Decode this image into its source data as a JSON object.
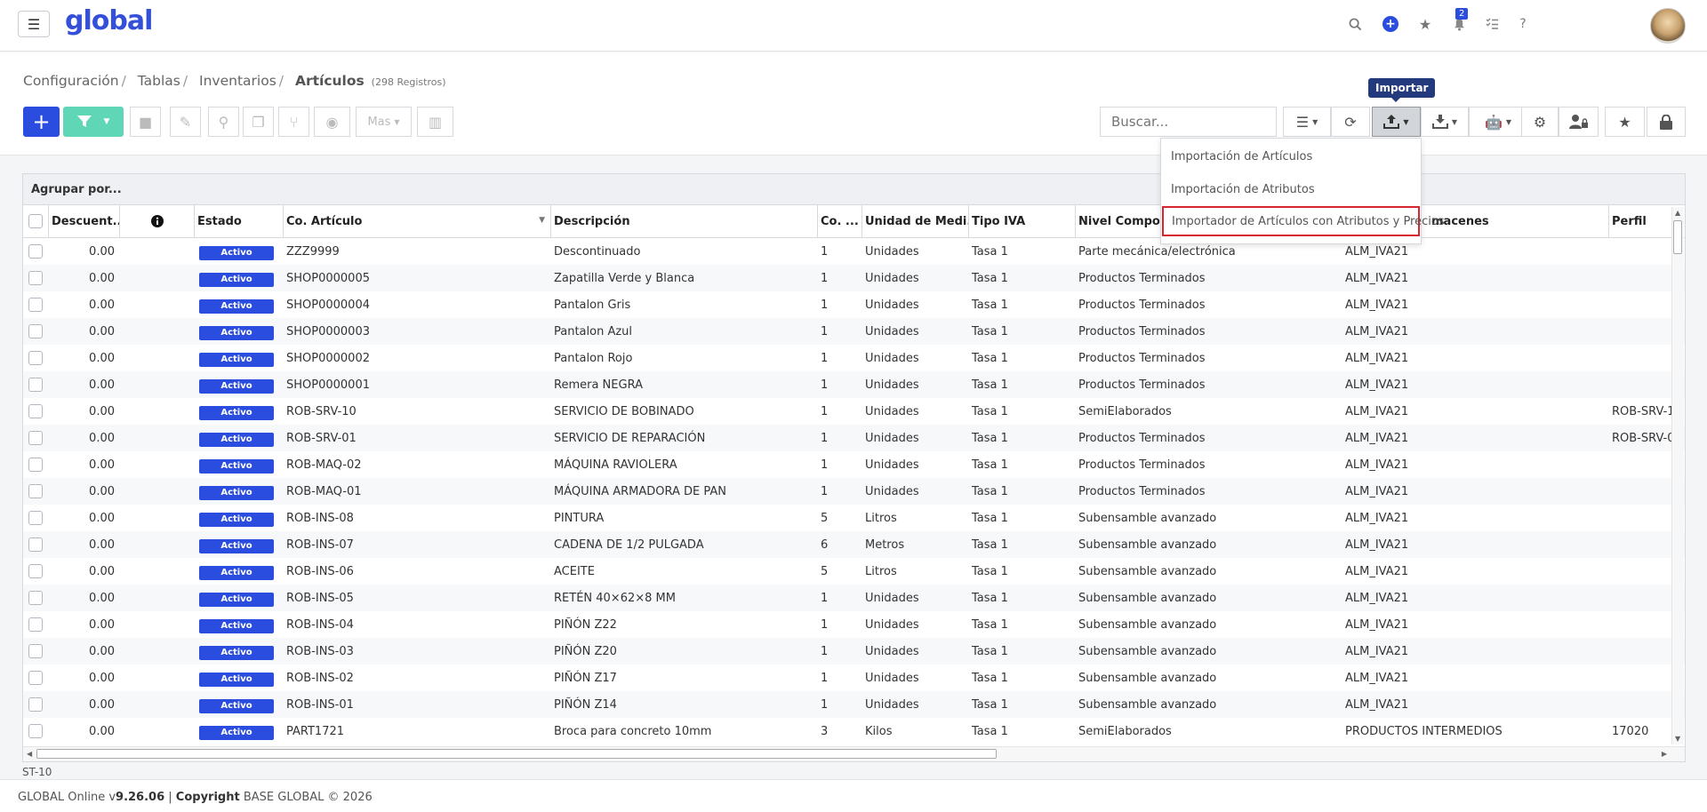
{
  "app": {
    "logo": "global"
  },
  "topbar": {
    "notifications_count": "2",
    "help_label": "?"
  },
  "breadcrumb": {
    "items": [
      "Configuración",
      "Tablas",
      "Inventarios"
    ],
    "current": "Artículos",
    "count": "(298 Registros)"
  },
  "toolbar": {
    "more_label": "Mas",
    "search_placeholder": "Buscar...",
    "tooltip": "Importar"
  },
  "import_menu": {
    "items": [
      "Importación de Artículos",
      "Importación de Atributos",
      "Importador de Artículos con Atributos y Precios"
    ]
  },
  "grid": {
    "group_by": "Agrupar por...",
    "columns": [
      "Descuent...",
      "",
      "Estado",
      "Co. Artículo",
      "Descripción",
      "Co. ...",
      "Unidad de Medi...",
      "Tipo IVA",
      "Nivel Composi",
      "macenes",
      "Perfil"
    ],
    "rows": [
      {
        "desc_pct": "0.00",
        "estado": "Activo",
        "codigo": "ZZZ9999",
        "descripcion": "Descontinuado",
        "co": "1",
        "unidad": "Unidades",
        "iva": "Tasa 1",
        "nivel": "Parte mecánica/electrónica",
        "almacen": "ALM_IVA21",
        "perfil": ""
      },
      {
        "desc_pct": "0.00",
        "estado": "Activo",
        "codigo": "SHOP0000005",
        "descripcion": "Zapatilla Verde y Blanca",
        "co": "1",
        "unidad": "Unidades",
        "iva": "Tasa 1",
        "nivel": "Productos Terminados",
        "almacen": "ALM_IVA21",
        "perfil": ""
      },
      {
        "desc_pct": "0.00",
        "estado": "Activo",
        "codigo": "SHOP0000004",
        "descripcion": "Pantalon Gris",
        "co": "1",
        "unidad": "Unidades",
        "iva": "Tasa 1",
        "nivel": "Productos Terminados",
        "almacen": "ALM_IVA21",
        "perfil": ""
      },
      {
        "desc_pct": "0.00",
        "estado": "Activo",
        "codigo": "SHOP0000003",
        "descripcion": "Pantalon Azul",
        "co": "1",
        "unidad": "Unidades",
        "iva": "Tasa 1",
        "nivel": "Productos Terminados",
        "almacen": "ALM_IVA21",
        "perfil": ""
      },
      {
        "desc_pct": "0.00",
        "estado": "Activo",
        "codigo": "SHOP0000002",
        "descripcion": "Pantalon Rojo",
        "co": "1",
        "unidad": "Unidades",
        "iva": "Tasa 1",
        "nivel": "Productos Terminados",
        "almacen": "ALM_IVA21",
        "perfil": ""
      },
      {
        "desc_pct": "0.00",
        "estado": "Activo",
        "codigo": "SHOP0000001",
        "descripcion": "Remera NEGRA",
        "co": "1",
        "unidad": "Unidades",
        "iva": "Tasa 1",
        "nivel": "Productos Terminados",
        "almacen": "ALM_IVA21",
        "perfil": ""
      },
      {
        "desc_pct": "0.00",
        "estado": "Activo",
        "codigo": "ROB-SRV-10",
        "descripcion": "SERVICIO DE BOBINADO",
        "co": "1",
        "unidad": "Unidades",
        "iva": "Tasa 1",
        "nivel": "SemiElaborados",
        "almacen": "ALM_IVA21",
        "perfil": "ROB-SRV-1("
      },
      {
        "desc_pct": "0.00",
        "estado": "Activo",
        "codigo": "ROB-SRV-01",
        "descripcion": "SERVICIO DE REPARACIÓN",
        "co": "1",
        "unidad": "Unidades",
        "iva": "Tasa 1",
        "nivel": "Productos Terminados",
        "almacen": "ALM_IVA21",
        "perfil": "ROB-SRV-0"
      },
      {
        "desc_pct": "0.00",
        "estado": "Activo",
        "codigo": "ROB-MAQ-02",
        "descripcion": "MÁQUINA RAVIOLERA",
        "co": "1",
        "unidad": "Unidades",
        "iva": "Tasa 1",
        "nivel": "Productos Terminados",
        "almacen": "ALM_IVA21",
        "perfil": ""
      },
      {
        "desc_pct": "0.00",
        "estado": "Activo",
        "codigo": "ROB-MAQ-01",
        "descripcion": "MÁQUINA ARMADORA DE PAN",
        "co": "1",
        "unidad": "Unidades",
        "iva": "Tasa 1",
        "nivel": "Productos Terminados",
        "almacen": "ALM_IVA21",
        "perfil": ""
      },
      {
        "desc_pct": "0.00",
        "estado": "Activo",
        "codigo": "ROB-INS-08",
        "descripcion": "PINTURA",
        "co": "5",
        "unidad": "Litros",
        "iva": "Tasa 1",
        "nivel": "Subensamble avanzado",
        "almacen": "ALM_IVA21",
        "perfil": ""
      },
      {
        "desc_pct": "0.00",
        "estado": "Activo",
        "codigo": "ROB-INS-07",
        "descripcion": "CADENA DE 1/2 PULGADA",
        "co": "6",
        "unidad": "Metros",
        "iva": "Tasa 1",
        "nivel": "Subensamble avanzado",
        "almacen": "ALM_IVA21",
        "perfil": ""
      },
      {
        "desc_pct": "0.00",
        "estado": "Activo",
        "codigo": "ROB-INS-06",
        "descripcion": "ACEITE",
        "co": "5",
        "unidad": "Litros",
        "iva": "Tasa 1",
        "nivel": "Subensamble avanzado",
        "almacen": "ALM_IVA21",
        "perfil": ""
      },
      {
        "desc_pct": "0.00",
        "estado": "Activo",
        "codigo": "ROB-INS-05",
        "descripcion": "RETÉN 40×62×8 MM",
        "co": "1",
        "unidad": "Unidades",
        "iva": "Tasa 1",
        "nivel": "Subensamble avanzado",
        "almacen": "ALM_IVA21",
        "perfil": ""
      },
      {
        "desc_pct": "0.00",
        "estado": "Activo",
        "codigo": "ROB-INS-04",
        "descripcion": "PIÑÓN Z22",
        "co": "1",
        "unidad": "Unidades",
        "iva": "Tasa 1",
        "nivel": "Subensamble avanzado",
        "almacen": "ALM_IVA21",
        "perfil": ""
      },
      {
        "desc_pct": "0.00",
        "estado": "Activo",
        "codigo": "ROB-INS-03",
        "descripcion": "PIÑÓN Z20",
        "co": "1",
        "unidad": "Unidades",
        "iva": "Tasa 1",
        "nivel": "Subensamble avanzado",
        "almacen": "ALM_IVA21",
        "perfil": ""
      },
      {
        "desc_pct": "0.00",
        "estado": "Activo",
        "codigo": "ROB-INS-02",
        "descripcion": "PIÑÓN Z17",
        "co": "1",
        "unidad": "Unidades",
        "iva": "Tasa 1",
        "nivel": "Subensamble avanzado",
        "almacen": "ALM_IVA21",
        "perfil": ""
      },
      {
        "desc_pct": "0.00",
        "estado": "Activo",
        "codigo": "ROB-INS-01",
        "descripcion": "PIÑÓN Z14",
        "co": "1",
        "unidad": "Unidades",
        "iva": "Tasa 1",
        "nivel": "Subensamble avanzado",
        "almacen": "ALM_IVA21",
        "perfil": ""
      },
      {
        "desc_pct": "0.00",
        "estado": "Activo",
        "codigo": "PART1721",
        "descripcion": "Broca para concreto 10mm",
        "co": "3",
        "unidad": "Kilos",
        "iva": "Tasa 1",
        "nivel": "SemiElaborados",
        "almacen": "PRODUCTOS INTERMEDIOS",
        "perfil": "17020"
      }
    ]
  },
  "status": {
    "code": "ST-10"
  },
  "footer": {
    "product": "GLOBAL Online v",
    "version": "9.26.06",
    "sep": " | ",
    "copyright_label": "Copyright",
    "copyright_text": " BASE GLOBAL © 2026"
  },
  "colors": {
    "primary": "#2a4de0",
    "filter": "#5fd6b6",
    "highlight_border": "#d9252e",
    "tooltip_bg": "#233a7c"
  }
}
